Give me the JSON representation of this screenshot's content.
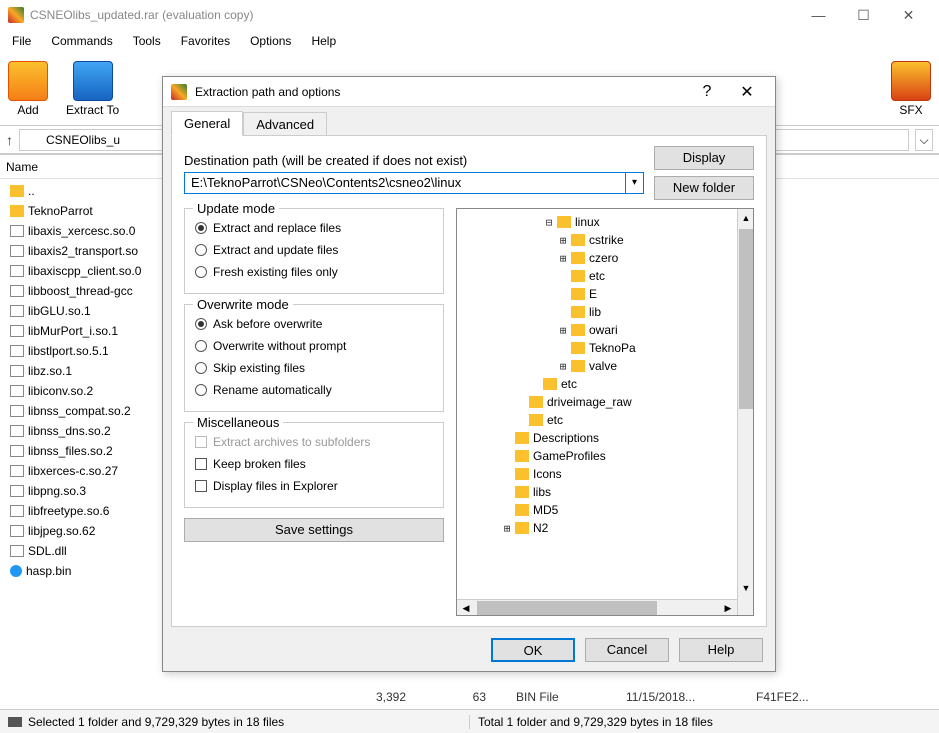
{
  "window": {
    "title": "CSNEOlibs_updated.rar (evaluation copy)"
  },
  "menu": {
    "file": "File",
    "commands": "Commands",
    "tools": "Tools",
    "favorites": "Favorites",
    "options": "Options",
    "help": "Help"
  },
  "toolbar": {
    "add": "Add",
    "extract_to": "Extract To",
    "sfx": "SFX"
  },
  "pathbar": {
    "archive_name": "CSNEOlibs_u"
  },
  "list_header": {
    "name": "Name"
  },
  "files": [
    {
      "name": "..",
      "icon": "folder"
    },
    {
      "name": "TeknoParrot",
      "icon": "folder"
    },
    {
      "name": "libaxis_xercesc.so.0",
      "icon": "file"
    },
    {
      "name": "libaxis2_transport.so",
      "icon": "file"
    },
    {
      "name": "libaxiscpp_client.so.0",
      "icon": "file"
    },
    {
      "name": "libboost_thread-gcc",
      "icon": "file"
    },
    {
      "name": "libGLU.so.1",
      "icon": "file"
    },
    {
      "name": "libMurPort_i.so.1",
      "icon": "file"
    },
    {
      "name": "libstlport.so.5.1",
      "icon": "file"
    },
    {
      "name": "libz.so.1",
      "icon": "file"
    },
    {
      "name": "libiconv.so.2",
      "icon": "file"
    },
    {
      "name": "libnss_compat.so.2",
      "icon": "file"
    },
    {
      "name": "libnss_dns.so.2",
      "icon": "file"
    },
    {
      "name": "libnss_files.so.2",
      "icon": "file"
    },
    {
      "name": "libxerces-c.so.27",
      "icon": "file"
    },
    {
      "name": "libpng.so.3",
      "icon": "file"
    },
    {
      "name": "libfreetype.so.6",
      "icon": "file"
    },
    {
      "name": "libjpeg.so.62",
      "icon": "file"
    },
    {
      "name": "SDL.dll",
      "icon": "file"
    },
    {
      "name": "hasp.bin",
      "icon": "circle"
    }
  ],
  "detail_row": {
    "size": "3,392",
    "packed": "63",
    "type": "BIN File",
    "modified": "11/15/2018...",
    "crc": "F41FE2..."
  },
  "statusbar": {
    "left": "Selected 1 folder and 9,729,329 bytes in 18 files",
    "right": "Total 1 folder and 9,729,329 bytes in 18 files"
  },
  "dialog": {
    "title": "Extraction path and options",
    "tabs": {
      "general": "General",
      "advanced": "Advanced"
    },
    "dest_label": "Destination path (will be created if does not exist)",
    "dest_value": "E:\\TeknoParrot\\CSNeo\\Contents2\\csneo2\\linux",
    "display_btn": "Display",
    "newfolder_btn": "New folder",
    "update_group": {
      "title": "Update mode",
      "opt1": "Extract and replace files",
      "opt2": "Extract and update files",
      "opt3": "Fresh existing files only"
    },
    "overwrite_group": {
      "title": "Overwrite mode",
      "opt1": "Ask before overwrite",
      "opt2": "Overwrite without prompt",
      "opt3": "Skip existing files",
      "opt4": "Rename automatically"
    },
    "misc_group": {
      "title": "Miscellaneous",
      "opt1": "Extract archives to subfolders",
      "opt2": "Keep broken files",
      "opt3": "Display files in Explorer"
    },
    "save_settings": "Save settings",
    "tree": [
      {
        "indent": 6,
        "exp": "-",
        "name": "linux"
      },
      {
        "indent": 7,
        "exp": "+",
        "name": "cstrike"
      },
      {
        "indent": 7,
        "exp": "+",
        "name": "czero"
      },
      {
        "indent": 7,
        "exp": "",
        "name": "etc"
      },
      {
        "indent": 7,
        "exp": "",
        "name": "E"
      },
      {
        "indent": 7,
        "exp": "",
        "name": "lib"
      },
      {
        "indent": 7,
        "exp": "+",
        "name": "owari"
      },
      {
        "indent": 7,
        "exp": "",
        "name": "TeknoPa"
      },
      {
        "indent": 7,
        "exp": "+",
        "name": "valve"
      },
      {
        "indent": 5,
        "exp": "",
        "name": "etc"
      },
      {
        "indent": 4,
        "exp": "",
        "name": "driveimage_raw"
      },
      {
        "indent": 4,
        "exp": "",
        "name": "etc"
      },
      {
        "indent": 3,
        "exp": "",
        "name": "Descriptions"
      },
      {
        "indent": 3,
        "exp": "",
        "name": "GameProfiles"
      },
      {
        "indent": 3,
        "exp": "",
        "name": "Icons"
      },
      {
        "indent": 3,
        "exp": "",
        "name": "libs"
      },
      {
        "indent": 3,
        "exp": "",
        "name": "MD5"
      },
      {
        "indent": 3,
        "exp": "+",
        "name": "N2"
      }
    ],
    "ok": "OK",
    "cancel": "Cancel",
    "help": "Help"
  }
}
